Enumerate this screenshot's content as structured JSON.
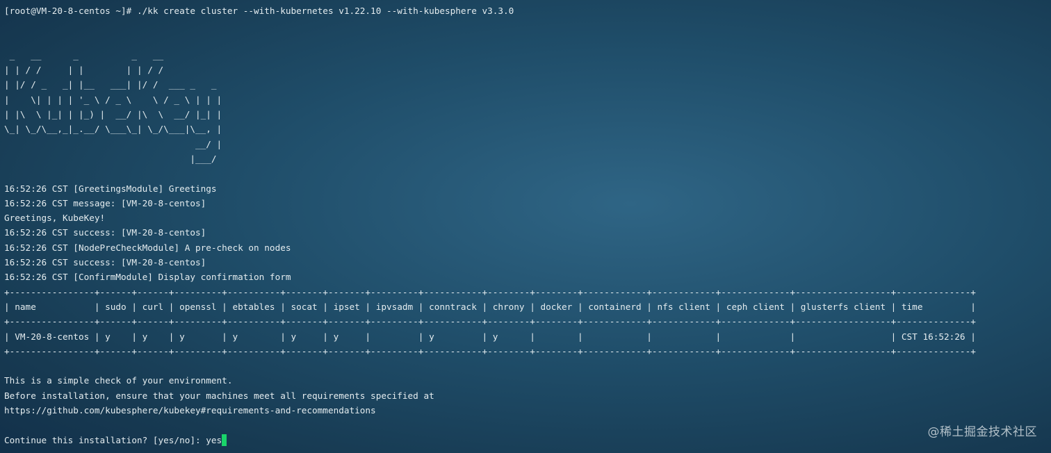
{
  "terminal": {
    "prompt_line": "[root@VM-20-8-centos ~]# ./kk create cluster --with-kubernetes v1.22.10 --with-kubesphere v3.3.0",
    "banner": [
      " _   __      _          _   __           ",
      "| | / /     | |        | | / /           ",
      "| |/ / _   _| |__   ___| |/ /  ___ _   _ ",
      "|    \\| | | | '_ \\ / _ \\    \\ / _ \\ | | |",
      "| |\\  \\ |_| | |_) |  __/ |\\  \\  __/ |_| |",
      "\\_| \\_/\\__,_|_.__/ \\___\\_| \\_/\\___|\\__, |",
      "                                    __/ |",
      "                                   |___/ "
    ],
    "logs": [
      "16:52:26 CST [GreetingsModule] Greetings",
      "16:52:26 CST message: [VM-20-8-centos]",
      "Greetings, KubeKey!",
      "16:52:26 CST success: [VM-20-8-centos]",
      "16:52:26 CST [NodePreCheckModule] A pre-check on nodes",
      "16:52:26 CST success: [VM-20-8-centos]",
      "16:52:26 CST [ConfirmModule] Display confirmation form"
    ],
    "table": {
      "border": "+----------------+------+------+---------+----------+-------+-------+---------+-----------+--------+--------+------------+------------+-------------+------------------+--------------+",
      "header": "| name           | sudo | curl | openssl | ebtables | socat | ipset | ipvsadm | conntrack | chrony | docker | containerd | nfs client | ceph client | glusterfs client | time         |",
      "row": "| VM-20-8-centos | y    | y    | y       | y        | y     | y     |         | y         | y      |        |            |            |             |                  | CST 16:52:26 |"
    },
    "notes": [
      "This is a simple check of your environment.",
      "Before installation, ensure that your machines meet all requirements specified at",
      "https://github.com/kubesphere/kubekey#requirements-and-recommendations"
    ],
    "confirm_prompt": "Continue this installation? [yes/no]: ",
    "confirm_input": "yes"
  },
  "watermark": "@稀土掘金技术社区",
  "colors": {
    "text": "#e4ecef",
    "cursor": "#19d46a"
  }
}
